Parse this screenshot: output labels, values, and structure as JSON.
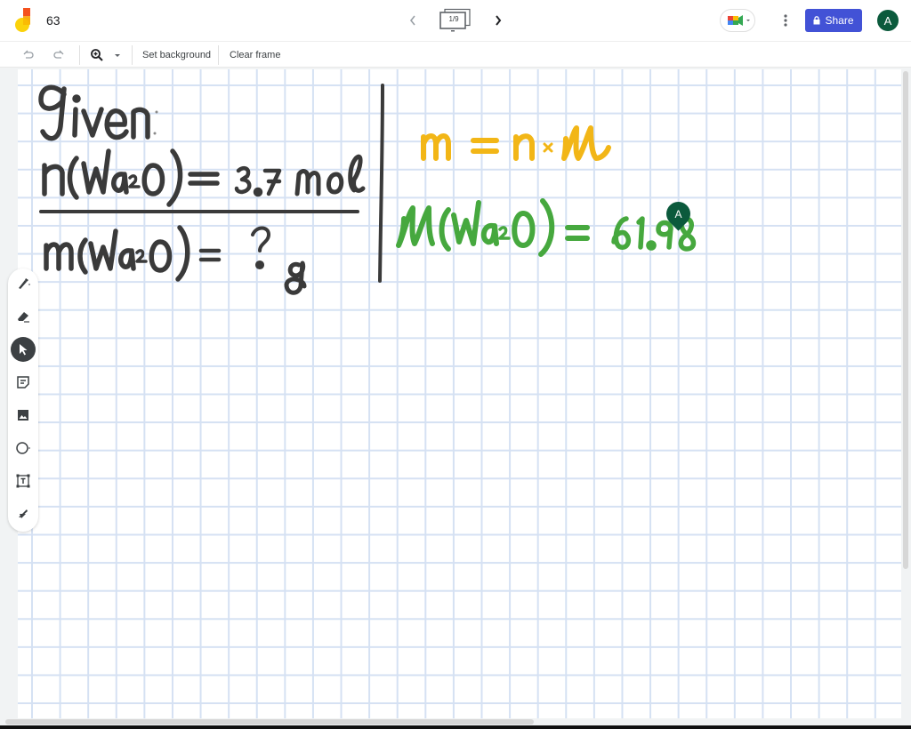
{
  "header": {
    "doc_title": "63",
    "frame_indicator": "1/9",
    "share_label": "Share",
    "user_initial": "A"
  },
  "toolbar": {
    "set_background_label": "Set background",
    "clear_frame_label": "Clear frame"
  },
  "side_tools": [
    {
      "name": "pen",
      "active": false
    },
    {
      "name": "eraser",
      "active": false
    },
    {
      "name": "select",
      "active": true
    },
    {
      "name": "sticky-note",
      "active": false
    },
    {
      "name": "image",
      "active": false
    },
    {
      "name": "circle",
      "active": false
    },
    {
      "name": "text-box",
      "active": false
    },
    {
      "name": "laser",
      "active": false
    }
  ],
  "canvas": {
    "background": "grid",
    "handwriting": {
      "given_label": "given:",
      "given_line_1": "n(Na2O) = 3.7 mol",
      "find_line": "m(Na2O) = ? g",
      "formula": "m = n × M",
      "molar_mass_line": "M(Na2O) = 61.98"
    },
    "ink_colors": {
      "dark": "#3a3a3a",
      "yellow": "#f2b617",
      "green": "#46a83e"
    },
    "collaborator_cursor_initial": "A"
  },
  "colors": {
    "share_button": "#4252d6",
    "avatar": "#0b5a3c"
  }
}
